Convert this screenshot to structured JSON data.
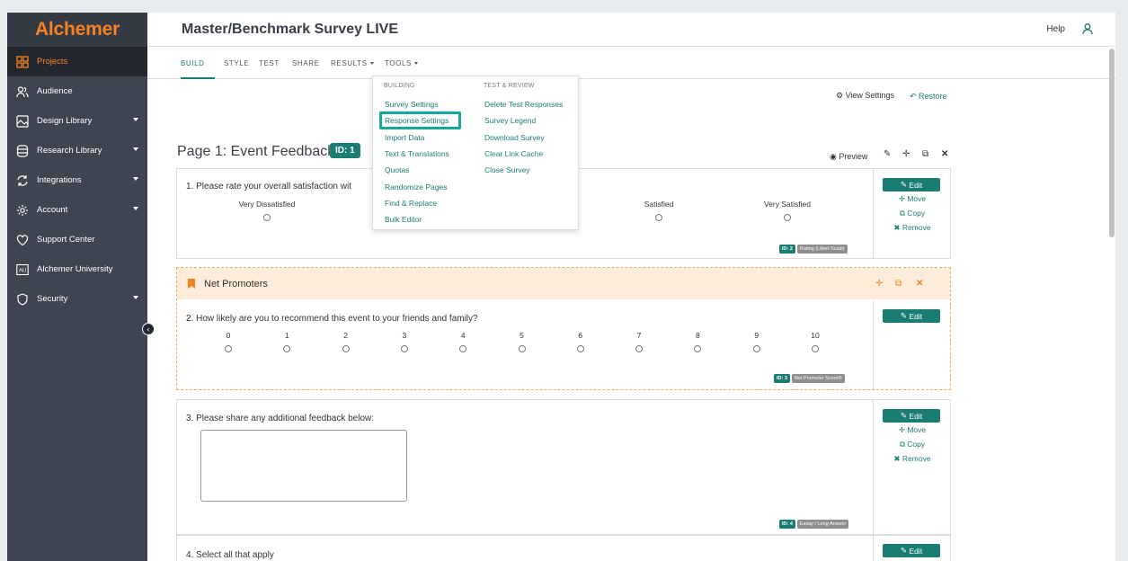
{
  "app": {
    "logo_text": "Alchemer",
    "survey_title": "Master/Benchmark Survey LIVE",
    "help_label": "Help"
  },
  "sidebar": {
    "items": [
      {
        "label": "Projects"
      },
      {
        "label": "Audience"
      },
      {
        "label": "Design Library"
      },
      {
        "label": "Research Library"
      },
      {
        "label": "Integrations"
      },
      {
        "label": "Account"
      },
      {
        "label": "Support Center"
      },
      {
        "label": "Alchemer University"
      },
      {
        "label": "Security"
      }
    ],
    "university_badge": "AU"
  },
  "tabs": {
    "build": "BUILD",
    "style": "STYLE",
    "test": "TEST",
    "share": "SHARE",
    "results": "RESULTS",
    "tools": "TOOLS"
  },
  "toolbar": {
    "view_settings": "View Settings",
    "restore": "Restore",
    "preview": "Preview"
  },
  "page": {
    "title": "Page 1: Event Feedback",
    "id_badge": "ID: 1"
  },
  "q1": {
    "text": "1. Please rate your overall satisfaction wit",
    "scale": [
      "Very Dissatisfied",
      "Satisfied",
      "Very Satisfied"
    ],
    "id_badge": "ID: 2",
    "type_badge": "Rating (Likert Scale)"
  },
  "nps": {
    "header": "Net Promoters",
    "text": "2. How likely are you to recommend this event to your friends and family?",
    "scale": [
      "0",
      "1",
      "2",
      "3",
      "4",
      "5",
      "6",
      "7",
      "8",
      "9",
      "10"
    ],
    "id_badge": "ID: 3",
    "type_badge": "Net Promoter Score®"
  },
  "q3": {
    "text": "3. Please share any additional feedback below:",
    "id_badge": "ID: 4",
    "type_badge": "Essay / Long Answer"
  },
  "q4": {
    "text": "4. Select all that apply"
  },
  "side_actions": {
    "edit": "Edit",
    "move": "Move",
    "copy": "Copy",
    "remove": "Remove"
  },
  "tools_menu": {
    "building_header": "BUILDING",
    "test_header": "TEST & REVIEW",
    "building": [
      "Survey Settings",
      "Response Settings",
      "Import Data",
      "Text & Translations",
      "Quotas",
      "Randomize Pages",
      "Find & Replace",
      "Bulk Editor"
    ],
    "test": [
      "Delete Test Responses",
      "Survey Legend",
      "Download Survey",
      "Clear Link Cache",
      "Close Survey"
    ]
  },
  "colors": {
    "accent": "#1a7d72",
    "brand": "#f58220",
    "sidebar": "#3e4550",
    "nps_header": "#fdecd8",
    "highlight": "#16a799"
  }
}
